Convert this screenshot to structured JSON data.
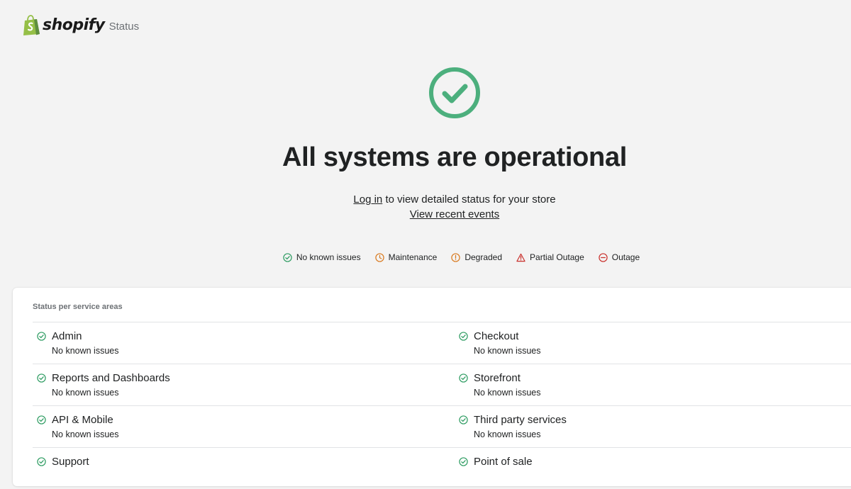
{
  "brand": {
    "wordmark": "shopify",
    "suffix": "Status",
    "color": "#95bf47"
  },
  "hero": {
    "icon": "check-circle-icon",
    "icon_color": "#4caf7d",
    "title": "All systems are operational",
    "login_link": "Log in",
    "login_rest": " to view detailed status for your store",
    "events_link": "View recent events"
  },
  "legend": [
    {
      "icon": "check-circle-icon",
      "label": "No known issues",
      "color": "#2e9c62"
    },
    {
      "icon": "clock-icon",
      "label": "Maintenance",
      "color": "#d97a1f"
    },
    {
      "icon": "exclamation-circle-icon",
      "label": "Degraded",
      "color": "#d97a1f"
    },
    {
      "icon": "warning-triangle-icon",
      "label": "Partial Outage",
      "color": "#c9302c"
    },
    {
      "icon": "minus-circle-icon",
      "label": "Outage",
      "color": "#c9302c"
    }
  ],
  "services_title": "Status per service areas",
  "services": [
    {
      "name": "Admin",
      "status": "No known issues"
    },
    {
      "name": "Checkout",
      "status": "No known issues"
    },
    {
      "name": "Reports and Dashboards",
      "status": "No known issues"
    },
    {
      "name": "Storefront",
      "status": "No known issues"
    },
    {
      "name": "API & Mobile",
      "status": "No known issues"
    },
    {
      "name": "Third party services",
      "status": "No known issues"
    },
    {
      "name": "Support",
      "status": ""
    },
    {
      "name": "Point of sale",
      "status": ""
    }
  ]
}
